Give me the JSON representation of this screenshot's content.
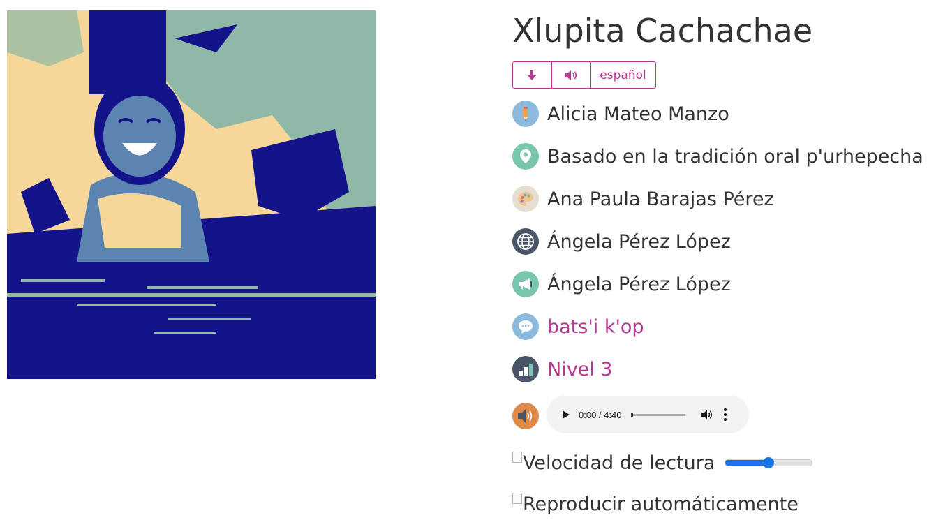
{
  "book": {
    "title": "Xlupita Cachachae",
    "cover_icon": "girl-in-water-illustration"
  },
  "actions": {
    "download_icon": "arrow-down-icon",
    "audio_icon": "speaker-icon",
    "language_label": "español"
  },
  "meta": {
    "author": "Alicia Mateo Manzo",
    "origin": "Basado en la tradición oral p'urhepecha",
    "illustrator": "Ana Paula Barajas Pérez",
    "translator": "Ángela Pérez López",
    "narrator": "Ángela Pérez López",
    "language": "bats'i k'op",
    "level": "Nivel 3"
  },
  "colors": {
    "accent": "#b5378f",
    "icon_blue": "#8bbadc",
    "icon_teal": "#7ac5b0",
    "icon_slate": "#4a5568",
    "icon_orange": "#e08a4a",
    "cover_navy": "#14138a",
    "cover_sand": "#f6d79a",
    "cover_teal": "#8fb9a6"
  },
  "player": {
    "time": "0:00 / 4:40",
    "progress": 0
  },
  "settings": {
    "reading_speed_label": "Velocidad de lectura",
    "reading_speed_value": 0.5,
    "autoplay_label": "Reproducir automáticamente"
  }
}
